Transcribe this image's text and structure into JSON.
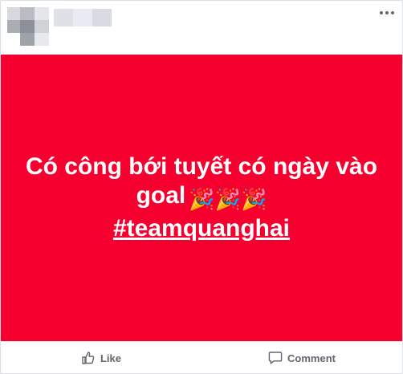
{
  "post": {
    "text_line1": "Có công bới tuyết có ngày vào",
    "text_line2": "goal",
    "emojis": "🎉🎉🎉",
    "hashtag": "#teamquanghai",
    "background": "#f5002f"
  },
  "actions": {
    "like_label": "Like",
    "comment_label": "Comment"
  },
  "icons": {
    "more": "more-options-icon",
    "like": "thumbs-up-icon",
    "comment": "speech-bubble-icon"
  }
}
